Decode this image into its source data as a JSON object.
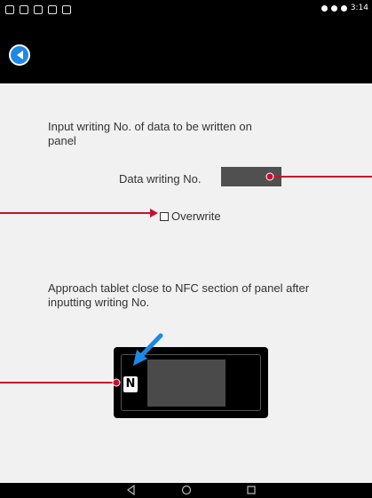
{
  "instructions": {
    "input_writing_no": "Input writing No. of data to be written on panel",
    "approach_tablet": "Approach tablet close to NFC section of panel after inputting writing No."
  },
  "data_writing": {
    "label": "Data writing No.",
    "value": ""
  },
  "overwrite": {
    "label": "Overwrite",
    "checked": false
  },
  "status_bar": {
    "time": "3:14"
  },
  "colors": {
    "accent_blue": "#1e88e5",
    "callout_red": "#c8102e",
    "bar_black": "#000000",
    "background": "#f1f1f1"
  },
  "icons": {
    "back": "back-arrow-icon",
    "nfc": "nfc-icon",
    "nav_back": "triangle-back-icon",
    "nav_home": "circle-home-icon",
    "nav_recent": "square-recent-icon"
  }
}
